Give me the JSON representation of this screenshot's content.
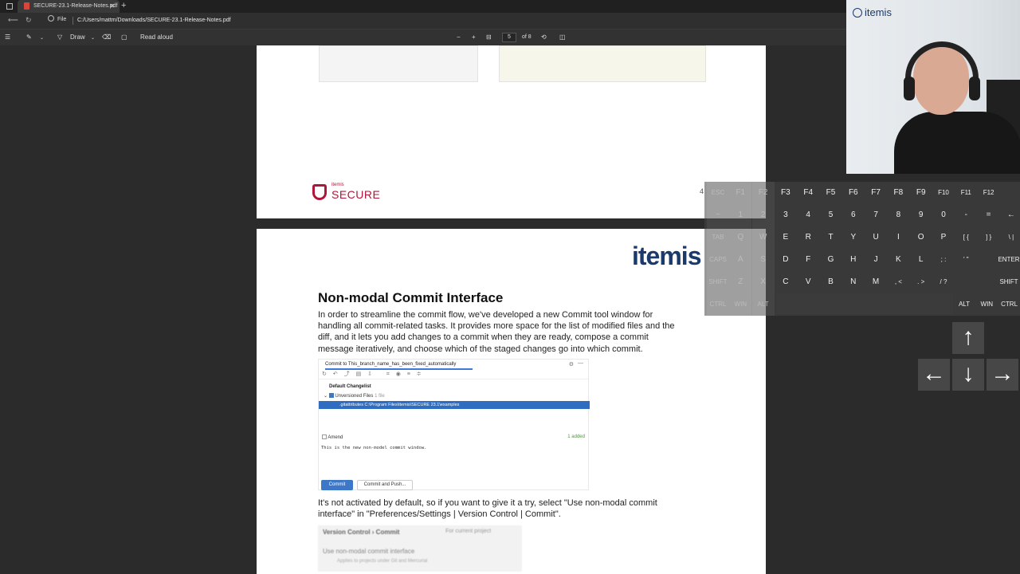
{
  "browser": {
    "tab_title": "SECURE-23.1-Release-Notes.pdf",
    "tab_close": "✕",
    "new_tab": "+",
    "file_label": "File",
    "url": "C:/Users/mattm/Downloads/SECURE-23.1-Release-Notes.pdf"
  },
  "pdf_toolbar": {
    "draw_label": "Draw",
    "read_aloud_label": "Read aloud",
    "zoom_out": "−",
    "zoom_in": "+",
    "page_current": "5",
    "page_total": "of 8"
  },
  "page1": {
    "logo_small": "itemis",
    "logo_word": "SECURE",
    "page_number": "4"
  },
  "page2": {
    "brand": "itemis",
    "heading": "Non-modal Commit Interface",
    "paragraph1_lines": [
      "In order to streamline the commit flow, we've developed a new Commit tool window for",
      "handling all commit-related tasks. It provides more space for the list of modified files and the",
      "diff, and it lets you add changes to a commit when they are ready, compose a commit",
      "message iteratively, and choose which of the staged changes go into which commit."
    ],
    "screenshot": {
      "title": "Commit to This_branch_name_has_been_fixed_automatically",
      "default_changelist": "Default Changelist",
      "unversioned": "Unversioned Files",
      "unversioned_count": "1 file",
      "selected_file": ".gitattributes  C:\\Program Files\\itemis\\SECURE 23.1\\examples",
      "amend": "Amend",
      "added": "1 added",
      "message": "This is the new non-model commit window.",
      "commit_button": "Commit",
      "commit_push_button": "Commit and Push..."
    },
    "paragraph2_lines": [
      "It's not activated by default, so if you want to give it a try, select \"Use non-modal commit",
      "interface\" in \"Preferences/Settings | Version Control | Commit\"."
    ],
    "blurred": {
      "crumb": "Version Control  ›  Commit",
      "scope": "For current project",
      "checkbox_label": "Use non-modal commit interface",
      "hint": "Applies to projects under Git and Mercurial"
    }
  },
  "keyboard": {
    "row1": [
      "ESC",
      "F1",
      "F2",
      "F3",
      "F4",
      "F5",
      "F6",
      "F7",
      "F8",
      "F9",
      "F10",
      "F11",
      "F12"
    ],
    "row2": [
      "~",
      "1",
      "2",
      "3",
      "4",
      "5",
      "6",
      "7",
      "8",
      "9",
      "0",
      "-",
      "=",
      "←"
    ],
    "row3": [
      "TAB",
      "Q",
      "W",
      "E",
      "R",
      "T",
      "Y",
      "U",
      "I",
      "O",
      "P",
      "[ {",
      "] }",
      "\\ |"
    ],
    "row4": [
      "CAPS",
      "A",
      "S",
      "D",
      "F",
      "G",
      "H",
      "J",
      "K",
      "L",
      "; :",
      "' \"",
      "ENTER"
    ],
    "row5": [
      "SHIFT",
      "Z",
      "X",
      "C",
      "V",
      "B",
      "N",
      "M",
      ", <",
      ". >",
      "/ ?",
      "SHIFT"
    ],
    "row6_left": [
      "CTRL",
      "WIN",
      "ALT"
    ],
    "row6_right": [
      "ALT",
      "WIN",
      "CTRL"
    ]
  },
  "arrows": {
    "up": "↑",
    "left": "←",
    "down": "↓",
    "right": "→"
  },
  "webcam": {
    "logo": "itemis"
  }
}
